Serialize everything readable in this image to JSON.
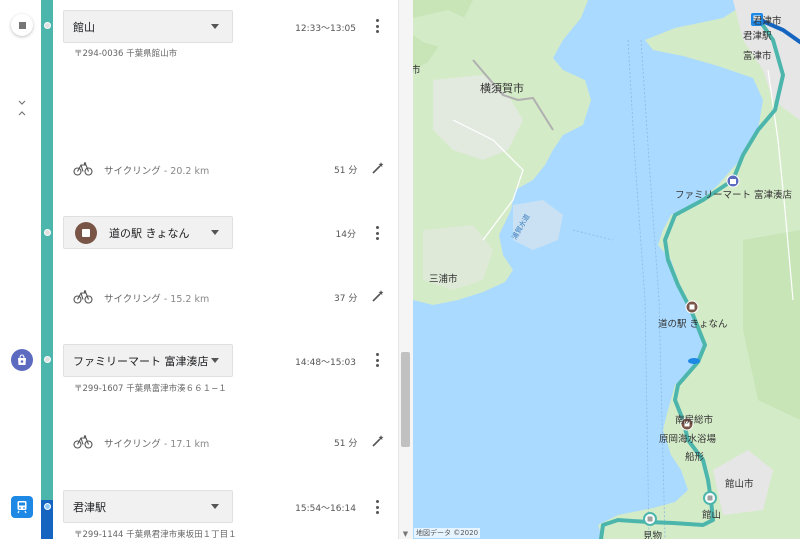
{
  "itinerary": {
    "stops": [
      {
        "name": "館山",
        "time": "12:33〜13:05",
        "address": "〒294-0036 千葉県館山市"
      },
      {
        "name": "道の駅 きょなん",
        "time": "14分",
        "address": ""
      },
      {
        "name": "ファミリーマート 富津湊店",
        "time": "14:48〜15:03",
        "address": "〒299-1607 千葉県富津市湊６６１−１"
      },
      {
        "name": "君津駅",
        "time": "15:54〜16:14",
        "address": "〒299-1144 千葉県君津市東坂田１丁目１"
      }
    ],
    "segments": [
      {
        "mode": "サイクリング",
        "distance": "- 20.2 km",
        "duration": "51 分"
      },
      {
        "mode": "サイクリング",
        "distance": "- 15.2 km",
        "duration": "37 分"
      },
      {
        "mode": "サイクリング",
        "distance": "- 17.1 km",
        "duration": "51 分"
      }
    ],
    "colors": {
      "route": "#4db6ac",
      "transit": "#1565c0",
      "stop_marker": "#795548",
      "shop_marker": "#5c6bc0"
    }
  },
  "map": {
    "labels": {
      "yokosuka": "横須賀市",
      "miura": "三浦市",
      "futtsu": "富津市",
      "kimitsu": "君津市",
      "kimitsu_station": "君津駅",
      "familymart": "ファミリーマート 富津湊店",
      "michinoeki": "道の駅 きょなん",
      "minamiboso": "南房総市",
      "haraoka": "原岡海水浴場",
      "funagata": "船形",
      "tateyama_city": "館山市",
      "tateyama": "館山",
      "mimono": "見物",
      "uraga": "浦賀水道",
      "partial_left": "市",
      "copyright": "地図データ ©2020"
    },
    "icons": [
      "train-station-icon",
      "shop-icon",
      "stop-icon"
    ]
  }
}
